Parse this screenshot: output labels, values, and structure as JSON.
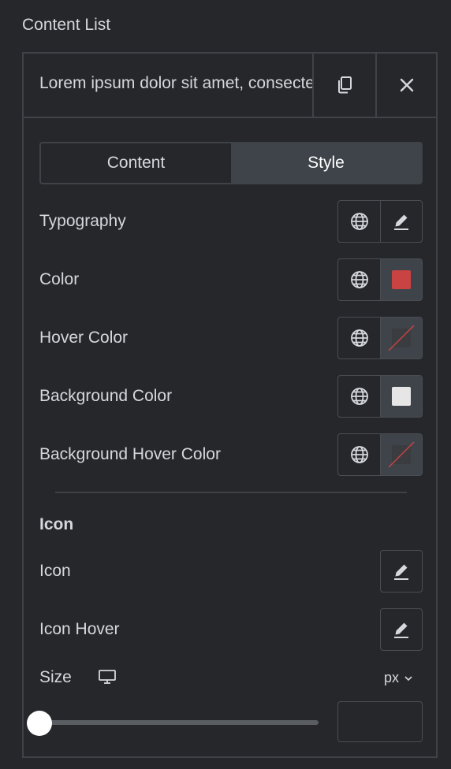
{
  "section": {
    "title": "Content List"
  },
  "item": {
    "title": "Lorem ipsum dolor sit amet, consectetur",
    "duplicate_icon": "copy-icon",
    "remove_icon": "close-icon"
  },
  "tabs": [
    {
      "label": "Content",
      "active": false
    },
    {
      "label": "Style",
      "active": true
    }
  ],
  "style_controls": [
    {
      "label": "Typography",
      "global_icon": "globe-icon",
      "action_icon": "pencil-icon"
    },
    {
      "label": "Color",
      "global_icon": "globe-icon",
      "swatch": "#c94343"
    },
    {
      "label": "Hover Color",
      "global_icon": "globe-icon",
      "swatch": "none"
    },
    {
      "label": "Background Color",
      "global_icon": "globe-icon",
      "swatch": "#e6e6e6"
    },
    {
      "label": "Background Hover Color",
      "global_icon": "globe-icon",
      "swatch": "none"
    }
  ],
  "icon_section": {
    "heading": "Icon",
    "controls": [
      {
        "label": "Icon",
        "action_icon": "pencil-icon"
      },
      {
        "label": "Icon Hover",
        "action_icon": "pencil-icon"
      }
    ]
  },
  "size": {
    "label": "Size",
    "device_icon": "desktop-icon",
    "unit": "px",
    "value": "",
    "slider_fraction": 0
  },
  "colors": {
    "background": "#26272b",
    "border": "#3f4247",
    "active_tab": "#3f444b",
    "color_swatch": "#c94343",
    "bg_swatch": "#e6e6e6",
    "none_slash": "#c94343"
  }
}
